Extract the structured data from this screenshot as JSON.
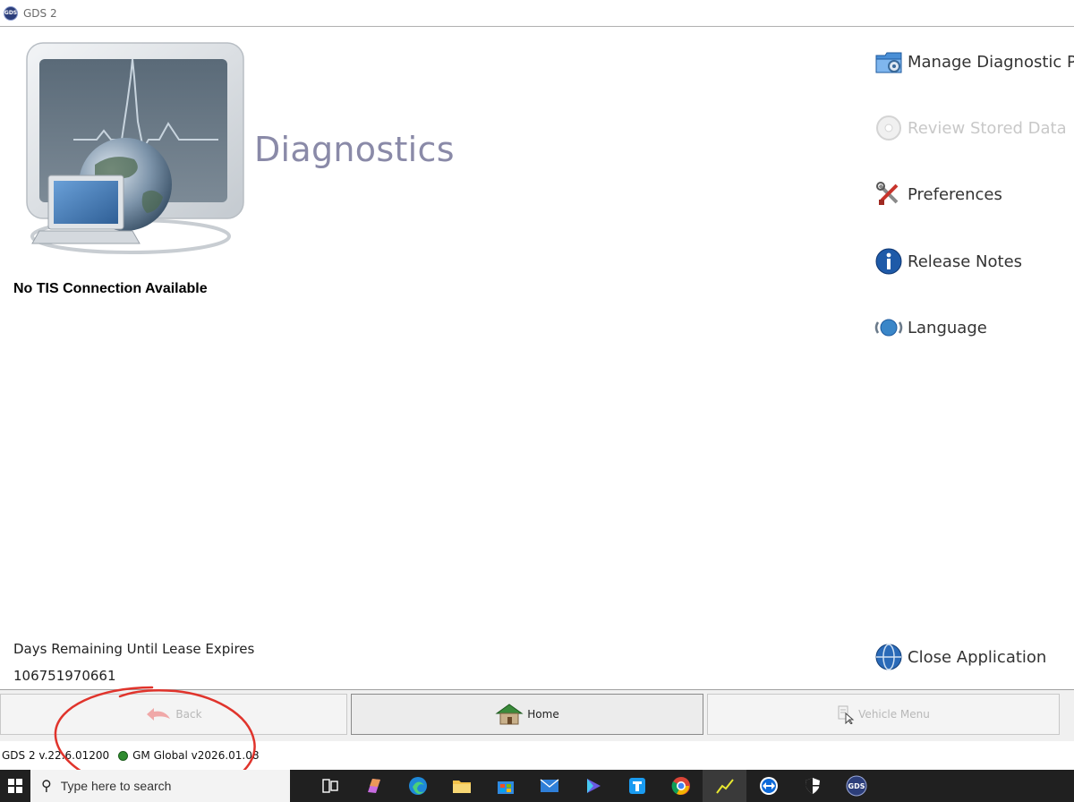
{
  "window": {
    "title": "GDS 2",
    "app_icon_text": "GDS"
  },
  "hero": {
    "title": "Diagnostics",
    "image_name": "diagnostics-monitor-globe"
  },
  "tis_status": "No TIS Connection Available",
  "menu": {
    "items": [
      {
        "label": "Manage Diagnostic Pac",
        "icon": "folder-gear-icon",
        "enabled": true
      },
      {
        "label": "Review Stored Data",
        "icon": "disc-icon",
        "enabled": false
      },
      {
        "label": "Preferences",
        "icon": "tools-icon",
        "enabled": true
      },
      {
        "label": "Release Notes",
        "icon": "info-icon",
        "enabled": true
      },
      {
        "label": "Language",
        "icon": "globe-arrows-icon",
        "enabled": true
      }
    ],
    "close": {
      "label": "Close Application",
      "icon": "globe-exit-icon"
    }
  },
  "lease": {
    "label": "Days Remaining Until Lease Expires",
    "value": "106751970661"
  },
  "nav": {
    "back": {
      "label": "Back",
      "enabled": false
    },
    "home": {
      "label": "Home",
      "enabled": true
    },
    "vehicle_menu": {
      "label": "Vehicle Menu",
      "enabled": false
    }
  },
  "status": {
    "version": "GDS 2 v.22.6.01200",
    "global": "GM Global v2026.01.08",
    "global_color": "#2e8b2e"
  },
  "taskbar": {
    "search_placeholder": "Type here to search",
    "icons": [
      "task-view-icon",
      "copilot-icon",
      "edge-icon",
      "file-explorer-icon",
      "store-icon",
      "mail-icon",
      "media-app-icon",
      "blue-app-icon",
      "chrome-icon",
      "scope-app-icon",
      "teamviewer-icon",
      "shield-icon",
      "gds-taskbar-icon"
    ]
  },
  "colors": {
    "hero_title": "#8a8aa8",
    "annotation": "#e0342c",
    "taskbar": "#202020"
  }
}
